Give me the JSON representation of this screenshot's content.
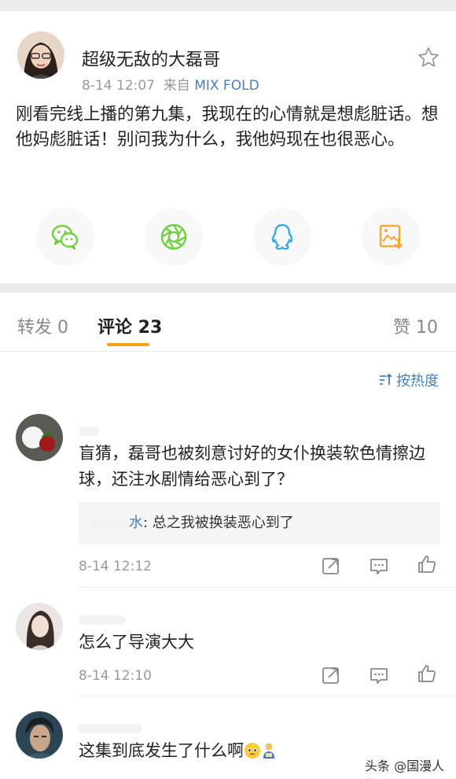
{
  "post": {
    "author": "超级无敌的大磊哥",
    "time": "8-14 12:07",
    "source_prefix": "来自",
    "device": "MIX FOLD",
    "body": "刚看完线上播的第九集，我现在的心情就是想彪脏话。想他妈彪脏话！别问我为什么，我他妈现在也很恶心。",
    "share_icons": [
      "wechat-icon",
      "moments-icon",
      "qq-icon",
      "save-image-icon"
    ]
  },
  "tabs": {
    "repost": "转发 0",
    "comments": "评论 23",
    "likes": "赞 10"
  },
  "sort_label": "按热度",
  "comments": [
    {
      "text": "盲猜，磊哥也被刻意讨好的女仆换装软色情擦边球，还注水剧情给恶心到了？",
      "reply_user": "水",
      "reply_text": ": 总之我被换装恶心到了",
      "time": "8-14 12:12"
    },
    {
      "text": "怎么了导演大大",
      "time": "8-14 12:10"
    },
    {
      "text": "这集到底发生了什么啊"
    }
  ],
  "watermark": "头条 @国漫人物",
  "colors": {
    "accent": "#f7a11a",
    "link": "#4a7fb0",
    "green": "#6fcf3f",
    "qq_blue": "#3aa8ea",
    "save_orange": "#f2a83a"
  }
}
